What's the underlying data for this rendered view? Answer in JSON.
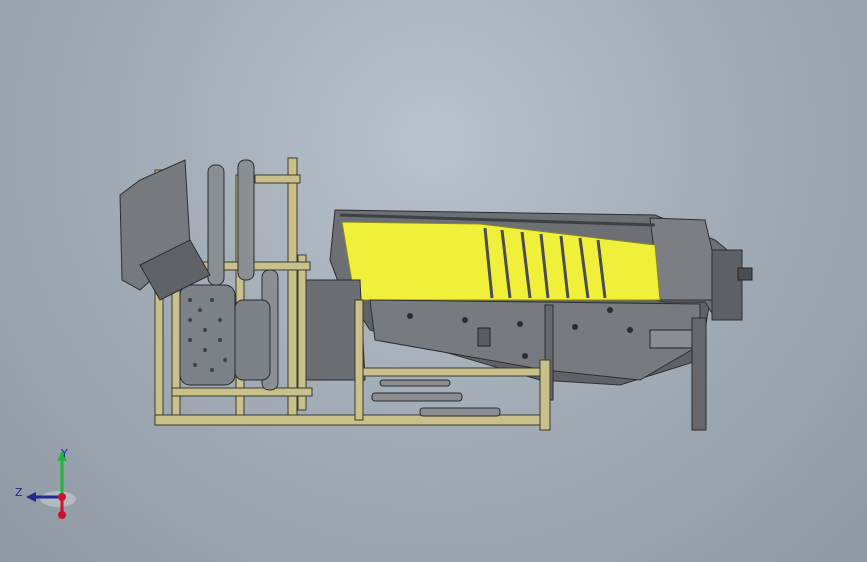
{
  "viewport": {
    "background_top": "#b9c2cc",
    "background_bottom": "#8f99a4"
  },
  "model": {
    "frame_color": "#c9c08c",
    "frame_edge": "#3a3a2a",
    "metal_color": "#6f7378",
    "metal_dark": "#4b4e52",
    "conveyor_color": "#f0f03a",
    "roller_color": "#8a8f94"
  },
  "triad": {
    "y_label": "Y",
    "z_label": "Z",
    "y_color": "#21b43a",
    "z_color": "#1e2a8c",
    "x_color": "#d0102a"
  }
}
